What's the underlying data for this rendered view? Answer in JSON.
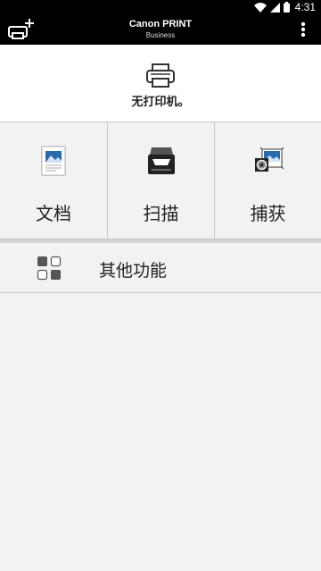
{
  "status_bar": {
    "time": "4:31",
    "icons": [
      "wifi-icon",
      "cellular-signal-icon",
      "battery-icon"
    ]
  },
  "app_bar": {
    "title": "Canon PRINT",
    "subtitle": "Business",
    "icons": [
      "add-printer-icon",
      "more-vert-icon"
    ]
  },
  "printer": {
    "status_text": "无打印机。",
    "icon": "printer-icon"
  },
  "tiles": [
    {
      "label": "文档",
      "icon": "document-icon"
    },
    {
      "label": "扫描",
      "icon": "scanner-icon"
    },
    {
      "label": "捕获",
      "icon": "capture-icon"
    }
  ],
  "more": {
    "label": "其他功能",
    "icon": "grid-apps-icon"
  },
  "colors": {
    "bar": "#000000",
    "background": "#f2f2f2",
    "panel": "#ffffff",
    "divider": "#c8c8c8"
  }
}
